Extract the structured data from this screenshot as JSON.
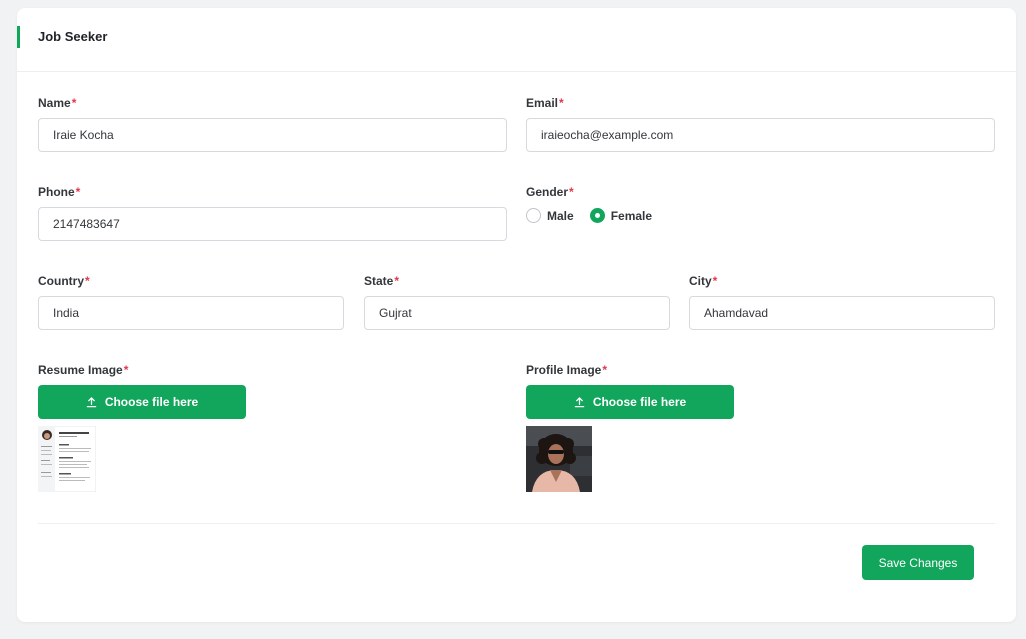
{
  "card": {
    "title": "Job Seeker"
  },
  "form": {
    "name": {
      "label": "Name",
      "value": "Iraie Kocha"
    },
    "email": {
      "label": "Email",
      "value": "iraieocha@example.com"
    },
    "phone": {
      "label": "Phone",
      "value": "2147483647"
    },
    "gender": {
      "label": "Gender",
      "options": [
        "Male",
        "Female"
      ],
      "selected": "Female"
    },
    "country": {
      "label": "Country",
      "value": "India"
    },
    "state": {
      "label": "State",
      "value": "Gujrat"
    },
    "city": {
      "label": "City",
      "value": "Ahamdavad"
    },
    "resume": {
      "label": "Resume Image",
      "button": "Choose file here"
    },
    "profile": {
      "label": "Profile Image",
      "button": "Choose file here"
    },
    "required_mark": "*"
  },
  "actions": {
    "save": "Save Changes"
  },
  "colors": {
    "accent": "#12a65c",
    "required": "#e5364a"
  }
}
